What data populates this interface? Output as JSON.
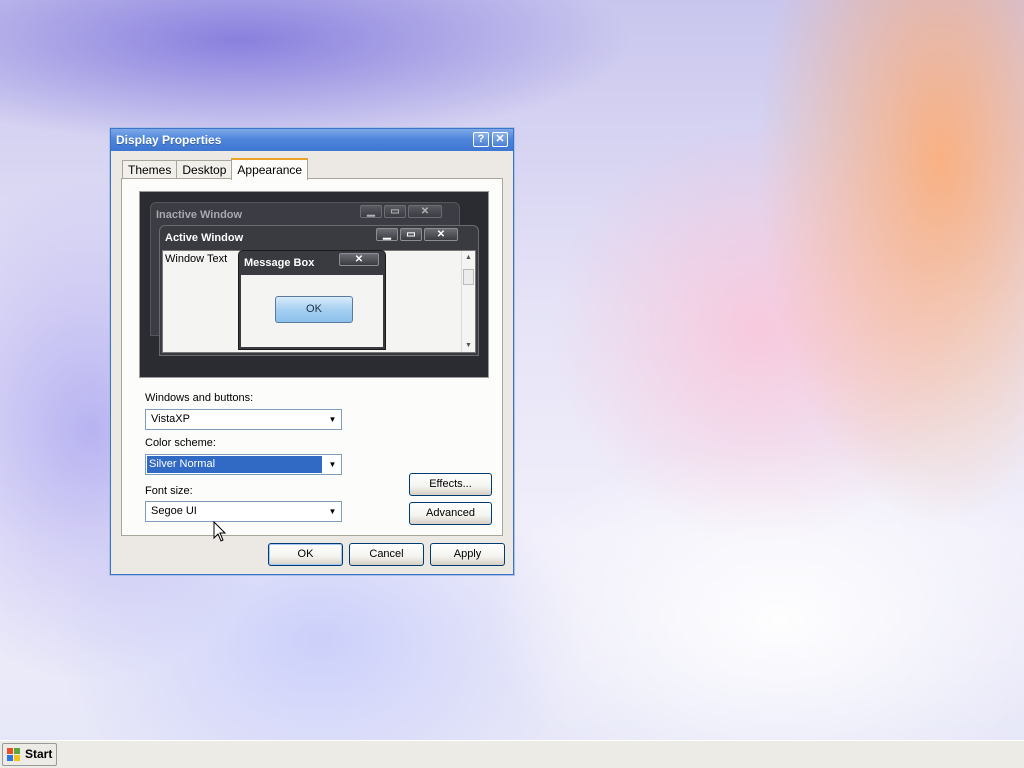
{
  "dialog": {
    "title": "Display Properties",
    "help_glyph": "?",
    "close_glyph": "✕",
    "tabs": [
      "Themes",
      "Desktop",
      "Appearance"
    ],
    "active_tab": "Appearance"
  },
  "preview": {
    "inactive_title": "Inactive Window",
    "active_title": "Active Window",
    "window_text": "Window Text",
    "messagebox_title": "Message Box",
    "messagebox_ok": "OK",
    "min_glyph": "▁",
    "max_glyph": "▭",
    "close_glyph": "✕"
  },
  "form": {
    "windows_buttons_label": "Windows and buttons:",
    "windows_buttons_value": "VistaXP",
    "color_scheme_label": "Color scheme:",
    "color_scheme_value": "Silver Normal",
    "font_size_label": "Font size:",
    "font_size_value": "Segoe UI",
    "dropdown_glyph": "▼"
  },
  "buttons": {
    "effects": "Effects...",
    "advanced": "Advanced",
    "ok": "OK",
    "cancel": "Cancel",
    "apply": "Apply"
  },
  "taskbar": {
    "start_label": "Start"
  },
  "colors": {
    "titlebar": "#3d76d2",
    "selection": "#316ac5",
    "dialog_bg": "#ece9e4"
  }
}
